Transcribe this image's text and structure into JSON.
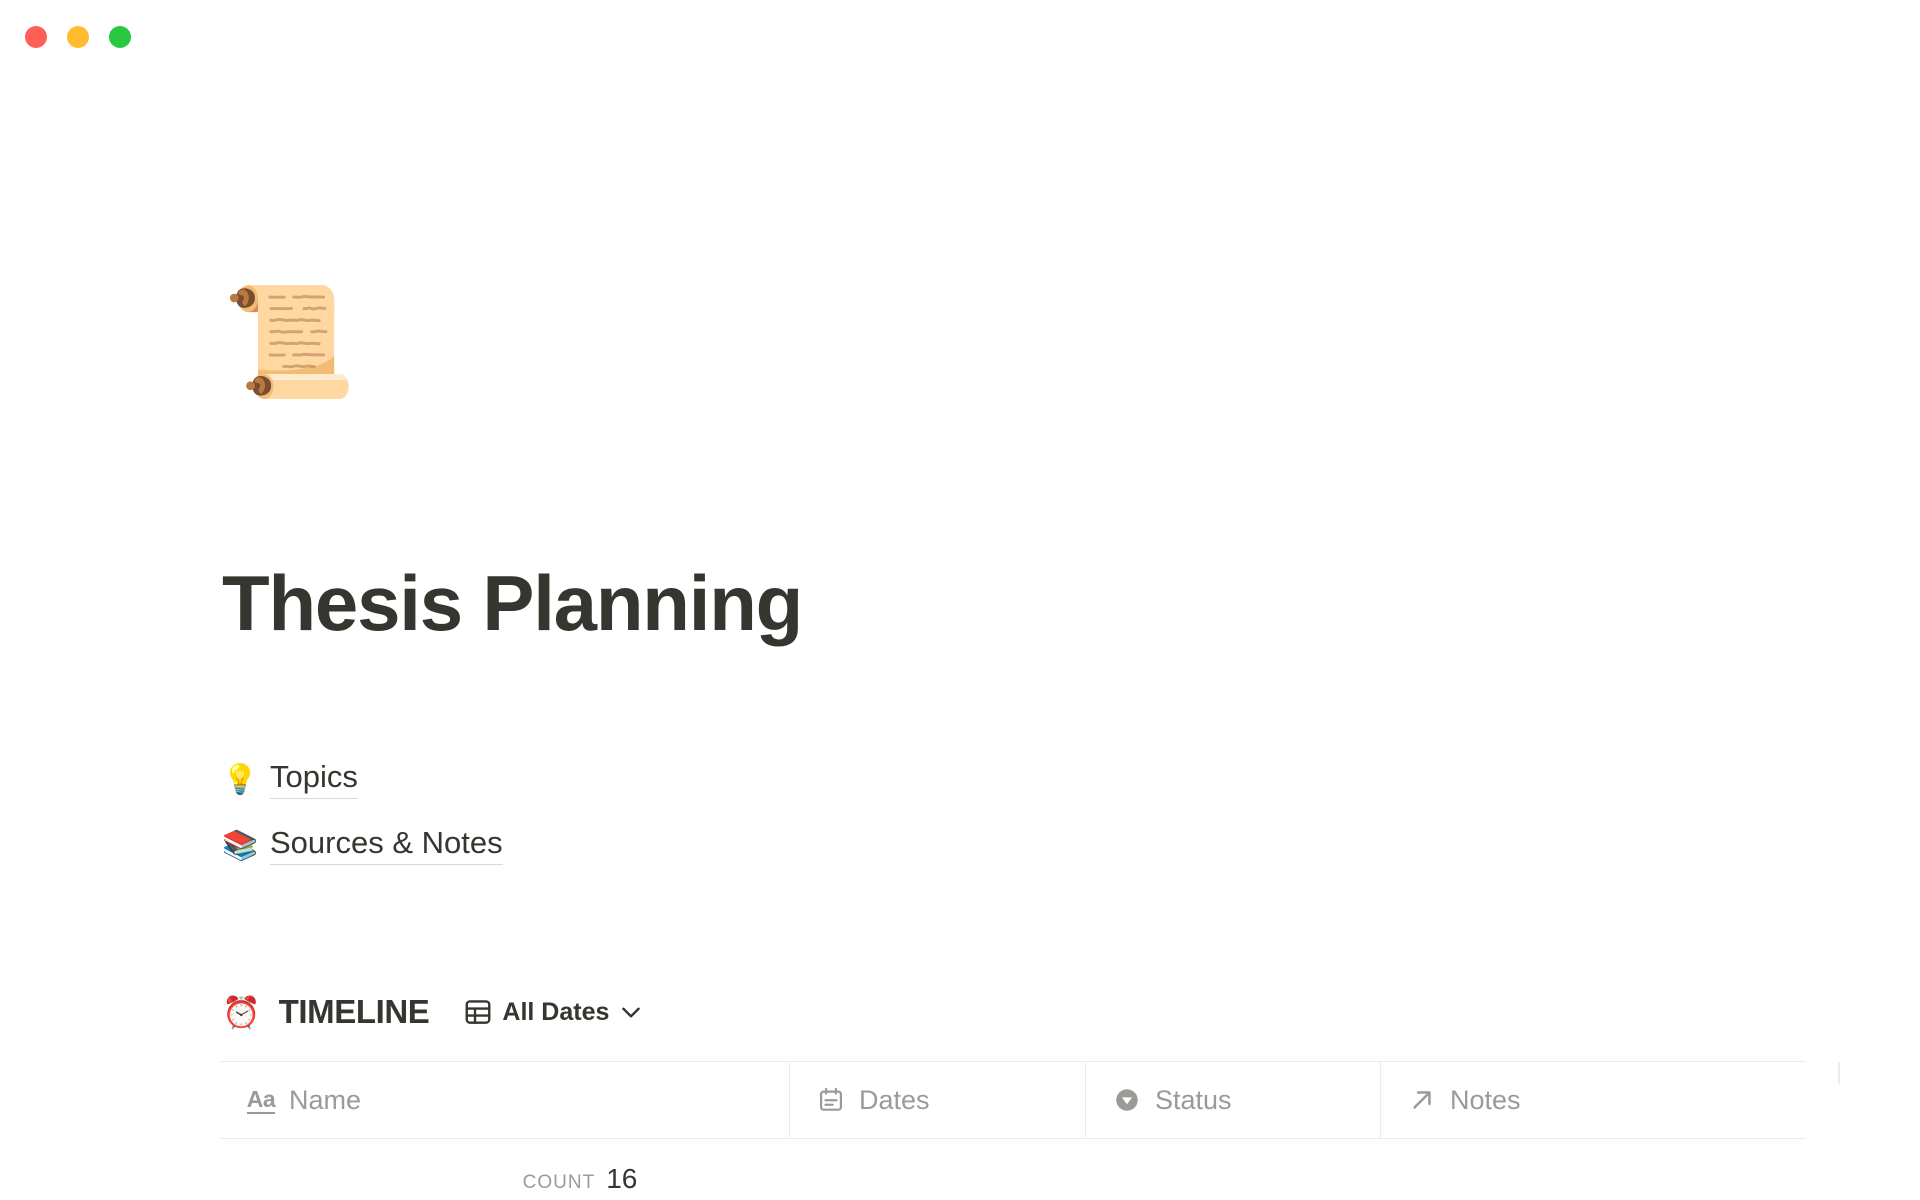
{
  "window": {
    "traffic_lights": [
      {
        "name": "close",
        "color": "#ff5f57"
      },
      {
        "name": "minimize",
        "color": "#febc2e"
      },
      {
        "name": "maximize",
        "color": "#28c840"
      }
    ]
  },
  "page": {
    "icon": "📜",
    "icon_name": "scroll-emoji",
    "title": "Thesis Planning",
    "title_color": "#37352f",
    "links": [
      {
        "emoji": "💡",
        "icon_name": "light-bulb-emoji",
        "label": "Topics"
      },
      {
        "emoji": "📚",
        "icon_name": "books-emoji",
        "label": "Sources & Notes"
      }
    ]
  },
  "database": {
    "emoji": "⏰",
    "emoji_name": "alarm-clock-emoji",
    "title": "TIMELINE",
    "view": {
      "icon_name": "table-grid-icon",
      "label": "All Dates",
      "chevron_name": "chevron-down-icon"
    },
    "columns": [
      {
        "icon_name": "text-aa-icon",
        "label": "Name"
      },
      {
        "icon_name": "calendar-date-icon",
        "label": "Dates"
      },
      {
        "icon_name": "select-circle-icon",
        "label": "Status"
      },
      {
        "icon_name": "relation-arrow-icon",
        "label": "Notes"
      }
    ],
    "footer": {
      "count_label": "COUNT",
      "count_value": "16"
    }
  }
}
